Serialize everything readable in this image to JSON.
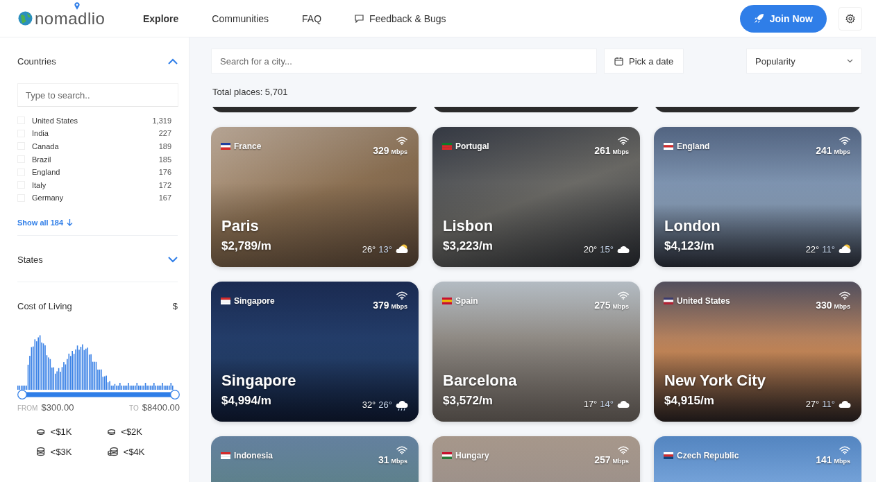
{
  "header": {
    "logo": "nomadlio",
    "nav": [
      {
        "label": "Explore",
        "selected": true
      },
      {
        "label": "Communities",
        "selected": false
      },
      {
        "label": "FAQ",
        "selected": false
      },
      {
        "label": "Feedback & Bugs",
        "selected": false
      }
    ],
    "join_button": "Join Now"
  },
  "sidebar": {
    "countries": {
      "title": "Countries",
      "expanded": true,
      "search_placeholder": "Type to search..",
      "items": [
        {
          "name": "United States",
          "count": "1,319",
          "checked": false
        },
        {
          "name": "India",
          "count": "227",
          "checked": false
        },
        {
          "name": "Canada",
          "count": "189",
          "checked": false
        },
        {
          "name": "Brazil",
          "count": "185",
          "checked": false
        },
        {
          "name": "England",
          "count": "176",
          "checked": false
        },
        {
          "name": "Italy",
          "count": "172",
          "checked": false
        },
        {
          "name": "Germany",
          "count": "167",
          "checked": false
        }
      ],
      "show_all": "Show all 184"
    },
    "states": {
      "title": "States",
      "expanded": false
    },
    "cost_of_living": {
      "title": "Cost of Living",
      "currency": "$",
      "slider": {
        "level": 1
      },
      "from_label": "FROM",
      "from_value": "$300.00",
      "to_label": "TO",
      "to_value": "$8400.00",
      "chips": [
        "<$1K",
        "<$2K",
        "<$3K",
        "<$4K"
      ]
    }
  },
  "toolbar": {
    "search_placeholder": "Search for a city...",
    "date_button": "Pick a date",
    "sort": "Popularity"
  },
  "total": "Total places: 5,701",
  "cards": [
    {
      "country": "France",
      "speed": "329",
      "unit": "Mbps",
      "city": "Paris",
      "price": "$2,789/m",
      "high": "26°",
      "low": "13°"
    },
    {
      "country": "Portugal",
      "speed": "261",
      "unit": "Mbps",
      "city": "Lisbon",
      "price": "$3,223/m",
      "high": "20°",
      "low": "15°"
    },
    {
      "country": "England",
      "speed": "241",
      "unit": "Mbps",
      "city": "London",
      "price": "$4,123/m",
      "high": "22°",
      "low": "11°"
    },
    {
      "country": "Singapore",
      "speed": "379",
      "unit": "Mbps",
      "city": "Singapore",
      "price": "$4,994/m",
      "high": "32°",
      "low": "26°"
    },
    {
      "country": "Spain",
      "speed": "275",
      "unit": "Mbps",
      "city": "Barcelona",
      "price": "$3,572/m",
      "high": "17°",
      "low": "14°"
    },
    {
      "country": "United States",
      "speed": "330",
      "unit": "Mbps",
      "city": "New York City",
      "price": "$4,915/m",
      "high": "27°",
      "low": "11°"
    },
    {
      "country": "Indonesia",
      "speed": "31",
      "unit": "Mbps"
    },
    {
      "country": "Hungary",
      "speed": "257",
      "unit": "Mbps"
    },
    {
      "country": "Czech Republic",
      "speed": "141",
      "unit": "Mbps"
    }
  ]
}
